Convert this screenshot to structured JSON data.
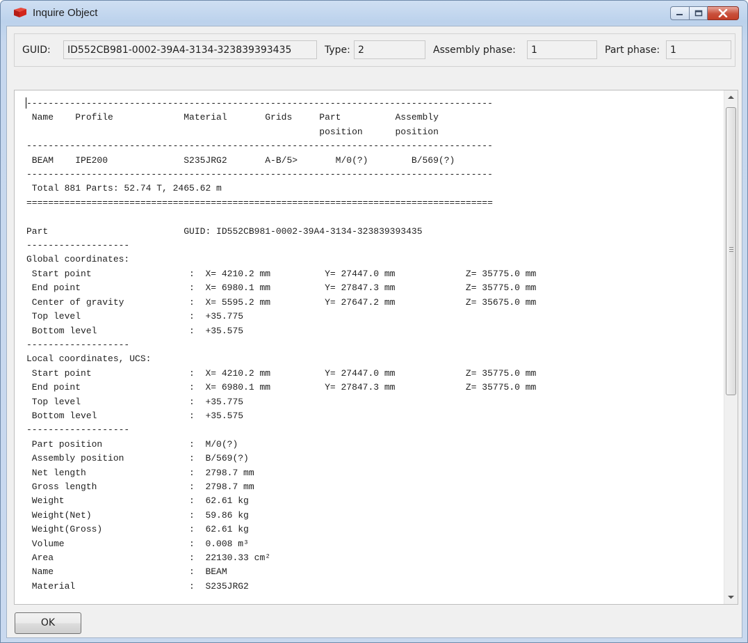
{
  "window": {
    "title": "Inquire Object",
    "icon": "app-logo-icon",
    "controls": [
      "minimize-icon",
      "maximize-icon",
      "close-icon"
    ]
  },
  "info": {
    "guid_label": "GUID:",
    "guid_value": "ID552CB981-0002-39A4-3134-323839393435",
    "type_label": "Type:",
    "type_value": "2",
    "assembly_phase_label": "Assembly phase:",
    "assembly_phase_value": "1",
    "part_phase_label": "Part phase:",
    "part_phase_value": "1"
  },
  "report_lines": [
    "--------------------------------------------------------------------------------------",
    " Name    Profile             Material       Grids     Part          Assembly",
    "                                                      position      position",
    "--------------------------------------------------------------------------------------",
    " BEAM    IPE200              S235JRG2       A-B/5>       M/0(?)        B/569(?)",
    "--------------------------------------------------------------------------------------",
    " Total 881 Parts: 52.74 T, 2465.62 m",
    "======================================================================================",
    "",
    "Part                         GUID: ID552CB981-0002-39A4-3134-323839393435",
    "-------------------",
    "Global coordinates:",
    " Start point                  :  X= 4210.2 mm          Y= 27447.0 mm             Z= 35775.0 mm",
    " End point                    :  X= 6980.1 mm          Y= 27847.3 mm             Z= 35775.0 mm",
    " Center of gravity            :  X= 5595.2 mm          Y= 27647.2 mm             Z= 35675.0 mm",
    " Top level                    :  +35.775",
    " Bottom level                 :  +35.575",
    "-------------------",
    "Local coordinates, UCS:",
    " Start point                  :  X= 4210.2 mm          Y= 27447.0 mm             Z= 35775.0 mm",
    " End point                    :  X= 6980.1 mm          Y= 27847.3 mm             Z= 35775.0 mm",
    " Top level                    :  +35.775",
    " Bottom level                 :  +35.575",
    "-------------------",
    " Part position                :  M/0(?)",
    " Assembly position            :  B/569(?)",
    " Net length                   :  2798.7 mm",
    " Gross length                 :  2798.7 mm",
    " Weight                       :  62.61 kg",
    " Weight(Net)                  :  59.86 kg",
    " Weight(Gross)                :  62.61 kg",
    " Volume                       :  0.008 m³",
    " Area                         :  22130.33 cm²",
    " Name                         :  BEAM",
    " Material                     :  S235JRG2"
  ],
  "buttons": {
    "ok_label": "OK"
  },
  "colors": {
    "title_bar": "#c6d7ee",
    "close_button": "#c8503b",
    "app_icon": "#d2261c"
  }
}
